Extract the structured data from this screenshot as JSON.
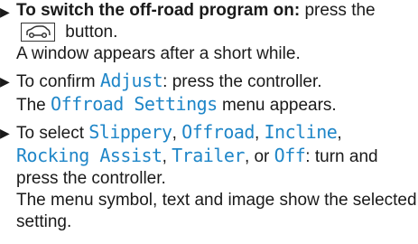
{
  "instructions": [
    {
      "lead": "To switch the off-road program on:",
      "text_a": " press the ",
      "icon": "offroad-car-icon",
      "text_b": " button.",
      "followup": "A window appears after a short while."
    },
    {
      "text_a": "To confirm ",
      "code": "Adjust",
      "text_b": ": press the controller.",
      "followup_a": "The ",
      "followup_code": "Offroad Settings",
      "followup_b": " menu appears."
    },
    {
      "text_a": "To select ",
      "opt1": "Slippery",
      "sep1": ", ",
      "opt2": "Offroad",
      "sep2": ", ",
      "opt3": "Incline",
      "sep3": ",",
      "opt4": "Rocking Assist",
      "sep4": ", ",
      "opt5": "Trailer",
      "sep5": ", or ",
      "opt6": "Off",
      "text_b": ": turn and press the controller.",
      "followup": "The menu symbol, text and image show the selected setting."
    }
  ],
  "bullet_glyph": "▶",
  "accent_color": "#1f86c8"
}
